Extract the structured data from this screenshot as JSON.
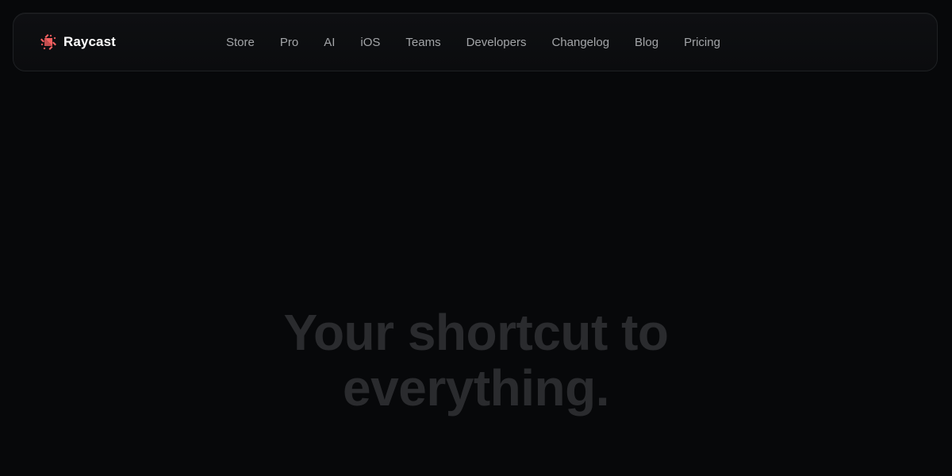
{
  "header": {
    "brand_name": "Raycast",
    "brand_accent": "#ff6363",
    "nav": [
      {
        "label": "Store"
      },
      {
        "label": "Pro"
      },
      {
        "label": "AI"
      },
      {
        "label": "iOS"
      },
      {
        "label": "Teams"
      },
      {
        "label": "Developers"
      },
      {
        "label": "Changelog"
      },
      {
        "label": "Blog"
      },
      {
        "label": "Pricing"
      }
    ]
  },
  "hero": {
    "title_line_1": "Your shortcut to",
    "title_line_2": "everything."
  }
}
